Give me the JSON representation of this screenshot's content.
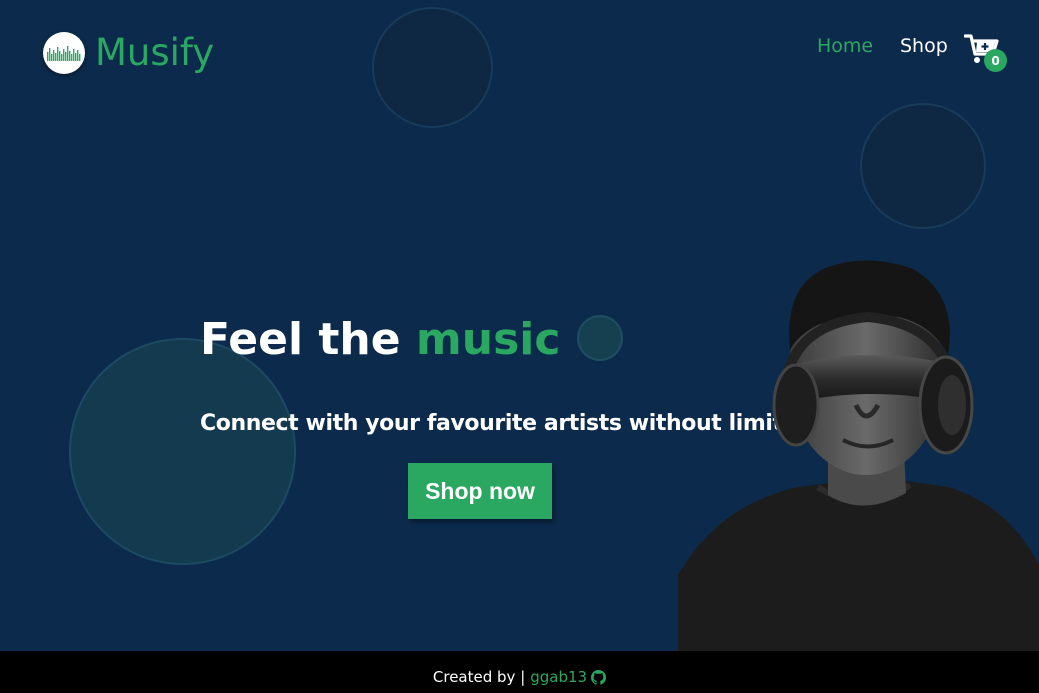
{
  "brand": {
    "name": "Musify"
  },
  "nav": {
    "home": "Home",
    "shop": "Shop"
  },
  "cart": {
    "count": "0"
  },
  "hero": {
    "title_prefix": "Feel the",
    "title_accent": "music",
    "subtitle": "Connect with your favourite artists without limits",
    "cta": "Shop now"
  },
  "footer": {
    "created_by": "Created by |",
    "author": "ggab13"
  },
  "colors": {
    "background": "#0c2a4b",
    "accent": "#2aa862",
    "footer": "#000000"
  },
  "icons": [
    "soundwave-logo-icon",
    "shopping-cart-icon",
    "github-icon"
  ]
}
